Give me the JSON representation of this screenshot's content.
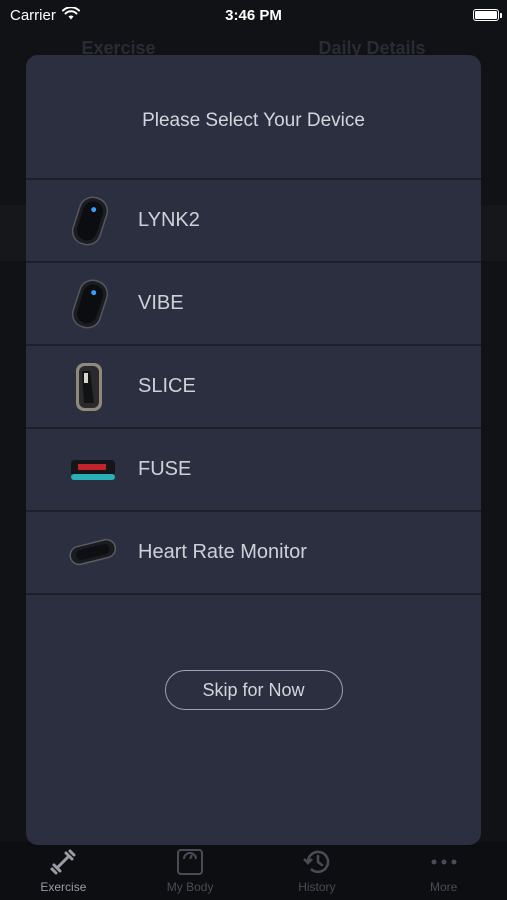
{
  "status_bar": {
    "carrier": "Carrier",
    "time": "3:46 PM"
  },
  "background": {
    "tab_left": "Exercise",
    "tab_right": "Daily Details"
  },
  "modal": {
    "title": "Please Select Your Device",
    "devices": [
      {
        "label": "LYNK2",
        "icon": "lynk2-device-icon"
      },
      {
        "label": "VIBE",
        "icon": "vibe-device-icon"
      },
      {
        "label": "SLICE",
        "icon": "slice-device-icon"
      },
      {
        "label": "FUSE",
        "icon": "fuse-device-icon"
      },
      {
        "label": "Heart Rate Monitor",
        "icon": "heart-rate-monitor-icon"
      }
    ],
    "skip_label": "Skip for Now"
  },
  "tab_bar": {
    "items": [
      {
        "label": "Exercise",
        "icon": "dumbbell-icon",
        "active": true
      },
      {
        "label": "My Body",
        "icon": "scale-icon",
        "active": false
      },
      {
        "label": "History",
        "icon": "history-icon",
        "active": false
      },
      {
        "label": "More",
        "icon": "more-icon",
        "active": false
      }
    ]
  },
  "colors": {
    "modal_bg": "#2c2f40",
    "divider": "#1d1f2b",
    "accent_blue": "#3aa0ff"
  }
}
